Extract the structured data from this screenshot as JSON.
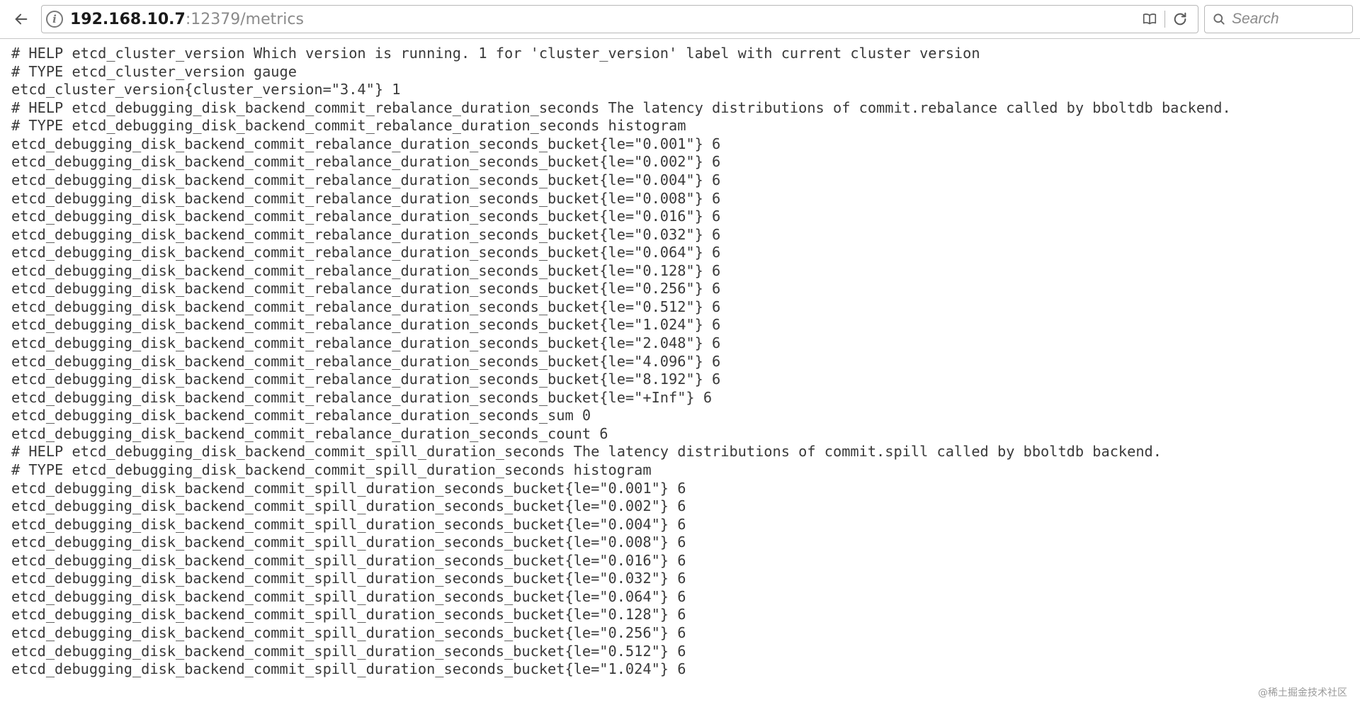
{
  "chrome": {
    "url_host": "192.168.10.7",
    "url_port": ":12379",
    "url_path": "/metrics",
    "search_placeholder": "Search"
  },
  "watermark": "@稀土掘金技术社区",
  "metrics": [
    {
      "name": "etcd_cluster_version",
      "help": "Which version is running. 1 for 'cluster_version' label with current cluster version",
      "type": "gauge",
      "samples": [
        {
          "labels": "{cluster_version=\"3.4\"}",
          "value": "1"
        }
      ]
    },
    {
      "name": "etcd_debugging_disk_backend_commit_rebalance_duration_seconds",
      "help": "The latency distributions of commit.rebalance called by bboltdb backend.",
      "type": "histogram",
      "samples": [
        {
          "suffix": "_bucket",
          "labels": "{le=\"0.001\"}",
          "value": "6"
        },
        {
          "suffix": "_bucket",
          "labels": "{le=\"0.002\"}",
          "value": "6"
        },
        {
          "suffix": "_bucket",
          "labels": "{le=\"0.004\"}",
          "value": "6"
        },
        {
          "suffix": "_bucket",
          "labels": "{le=\"0.008\"}",
          "value": "6"
        },
        {
          "suffix": "_bucket",
          "labels": "{le=\"0.016\"}",
          "value": "6"
        },
        {
          "suffix": "_bucket",
          "labels": "{le=\"0.032\"}",
          "value": "6"
        },
        {
          "suffix": "_bucket",
          "labels": "{le=\"0.064\"}",
          "value": "6"
        },
        {
          "suffix": "_bucket",
          "labels": "{le=\"0.128\"}",
          "value": "6"
        },
        {
          "suffix": "_bucket",
          "labels": "{le=\"0.256\"}",
          "value": "6"
        },
        {
          "suffix": "_bucket",
          "labels": "{le=\"0.512\"}",
          "value": "6"
        },
        {
          "suffix": "_bucket",
          "labels": "{le=\"1.024\"}",
          "value": "6"
        },
        {
          "suffix": "_bucket",
          "labels": "{le=\"2.048\"}",
          "value": "6"
        },
        {
          "suffix": "_bucket",
          "labels": "{le=\"4.096\"}",
          "value": "6"
        },
        {
          "suffix": "_bucket",
          "labels": "{le=\"8.192\"}",
          "value": "6"
        },
        {
          "suffix": "_bucket",
          "labels": "{le=\"+Inf\"}",
          "value": "6"
        },
        {
          "suffix": "_sum",
          "labels": "",
          "value": "0"
        },
        {
          "suffix": "_count",
          "labels": "",
          "value": "6"
        }
      ]
    },
    {
      "name": "etcd_debugging_disk_backend_commit_spill_duration_seconds",
      "help": "The latency distributions of commit.spill called by bboltdb backend.",
      "type": "histogram",
      "samples": [
        {
          "suffix": "_bucket",
          "labels": "{le=\"0.001\"}",
          "value": "6"
        },
        {
          "suffix": "_bucket",
          "labels": "{le=\"0.002\"}",
          "value": "6"
        },
        {
          "suffix": "_bucket",
          "labels": "{le=\"0.004\"}",
          "value": "6"
        },
        {
          "suffix": "_bucket",
          "labels": "{le=\"0.008\"}",
          "value": "6"
        },
        {
          "suffix": "_bucket",
          "labels": "{le=\"0.016\"}",
          "value": "6"
        },
        {
          "suffix": "_bucket",
          "labels": "{le=\"0.032\"}",
          "value": "6"
        },
        {
          "suffix": "_bucket",
          "labels": "{le=\"0.064\"}",
          "value": "6"
        },
        {
          "suffix": "_bucket",
          "labels": "{le=\"0.128\"}",
          "value": "6"
        },
        {
          "suffix": "_bucket",
          "labels": "{le=\"0.256\"}",
          "value": "6"
        },
        {
          "suffix": "_bucket",
          "labels": "{le=\"0.512\"}",
          "value": "6"
        },
        {
          "suffix": "_bucket",
          "labels": "{le=\"1.024\"}",
          "value": "6"
        }
      ]
    }
  ]
}
